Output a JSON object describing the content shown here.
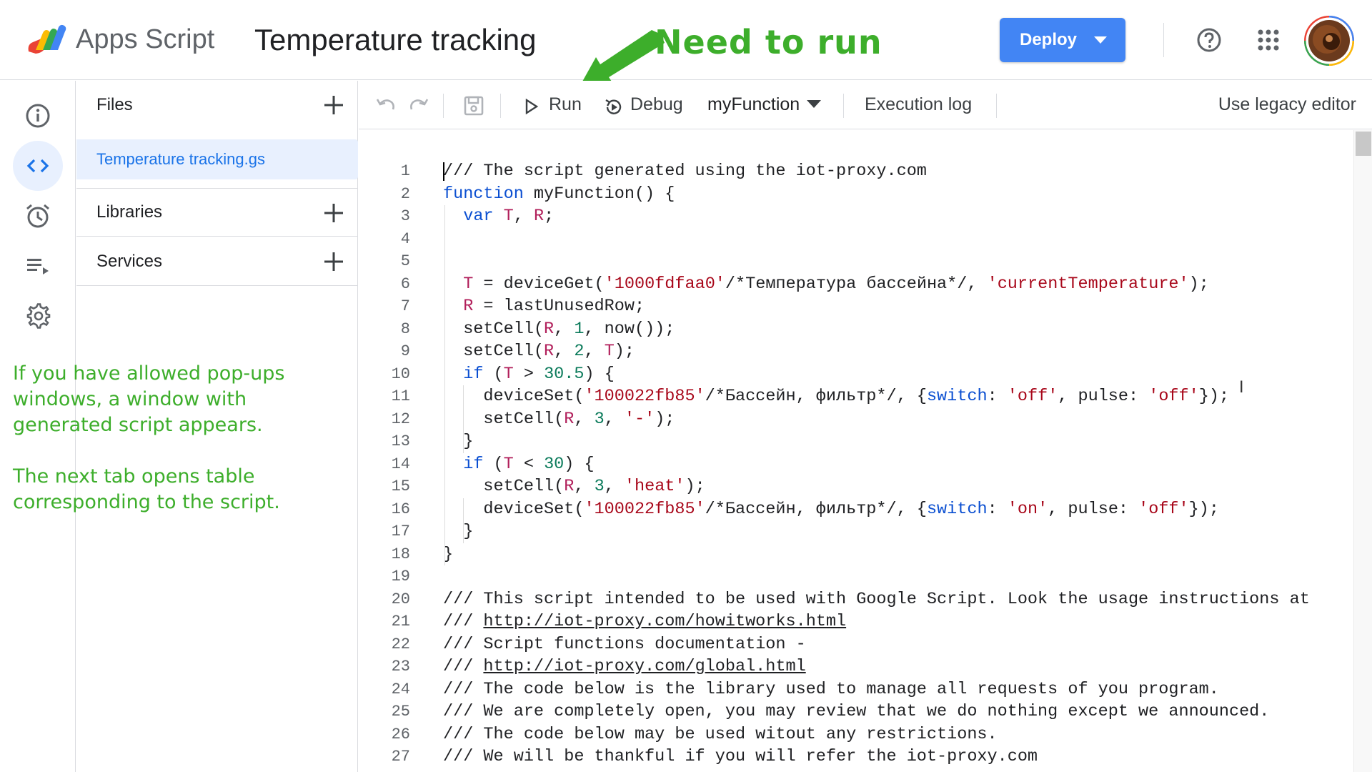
{
  "header": {
    "product_name": "Apps Script",
    "project_title": "Temperature tracking",
    "deploy_label": "Deploy",
    "help_icon": "help-circle-icon",
    "apps_icon": "apps-grid-icon",
    "brand_color": "#4285f4"
  },
  "annotations": {
    "run_hint": "Need to run",
    "popup_hint": "If you have allowed pop-ups windows, a window with generated script appears.",
    "tab_hint": "The next tab opens table corresponding to the script.",
    "color": "#3dae2b"
  },
  "rail": {
    "items": [
      {
        "name": "overview",
        "icon": "info-icon"
      },
      {
        "name": "editor",
        "icon": "code-icon",
        "active": true
      },
      {
        "name": "triggers",
        "icon": "alarm-clock-icon"
      },
      {
        "name": "executions",
        "icon": "list-play-icon"
      },
      {
        "name": "settings",
        "icon": "gear-icon"
      }
    ]
  },
  "files_panel": {
    "files_label": "Files",
    "active_file": "Temperature tracking.gs",
    "libraries_label": "Libraries",
    "services_label": "Services"
  },
  "toolbar": {
    "run_label": "Run",
    "debug_label": "Debug",
    "function_select": "myFunction",
    "execution_log_label": "Execution log",
    "legacy_editor_label": "Use legacy editor"
  },
  "editor": {
    "lines": [
      {
        "n": "1",
        "text": "/// The script generated using the iot-proxy.com"
      },
      {
        "n": "2",
        "text": "function myFunction() {"
      },
      {
        "n": "3",
        "text": "  var T, R;"
      },
      {
        "n": "4",
        "text": ""
      },
      {
        "n": "5",
        "text": ""
      },
      {
        "n": "6",
        "text": "  T = deviceGet('1000fdfaa0'/*Температура бассейна*/, 'currentTemperature');"
      },
      {
        "n": "7",
        "text": "  R = lastUnusedRow;"
      },
      {
        "n": "8",
        "text": "  setCell(R, 1, now());"
      },
      {
        "n": "9",
        "text": "  setCell(R, 2, T);"
      },
      {
        "n": "10",
        "text": "  if (T > 30.5) {"
      },
      {
        "n": "11",
        "text": "    deviceSet('100022fb85'/*Бассейн, фильтр*/, {switch: 'off', pulse: 'off'});"
      },
      {
        "n": "12",
        "text": "    setCell(R, 3, '-');"
      },
      {
        "n": "13",
        "text": "  }"
      },
      {
        "n": "14",
        "text": "  if (T < 30) {"
      },
      {
        "n": "15",
        "text": "    setCell(R, 3, 'heat');"
      },
      {
        "n": "16",
        "text": "    deviceSet('100022fb85'/*Бассейн, фильтр*/, {switch: 'on', pulse: 'off'});"
      },
      {
        "n": "17",
        "text": "  }"
      },
      {
        "n": "18",
        "text": "}"
      },
      {
        "n": "19",
        "text": ""
      },
      {
        "n": "20",
        "text": "/// This script intended to be used with Google Script. Look the usage instructions at"
      },
      {
        "n": "21",
        "text": "/// http://iot-proxy.com/howitworks.html"
      },
      {
        "n": "22",
        "text": "/// Script functions documentation -"
      },
      {
        "n": "23",
        "text": "/// http://iot-proxy.com/global.html"
      },
      {
        "n": "24",
        "text": "/// The code below is the library used to manage all requests of you program."
      },
      {
        "n": "25",
        "text": "/// We are completely open, you may review that we do nothing except we announced."
      },
      {
        "n": "26",
        "text": "/// The code below may be used witout any restrictions."
      },
      {
        "n": "27",
        "text": "/// We will be thankful if you will refer the iot-proxy.com"
      }
    ]
  }
}
